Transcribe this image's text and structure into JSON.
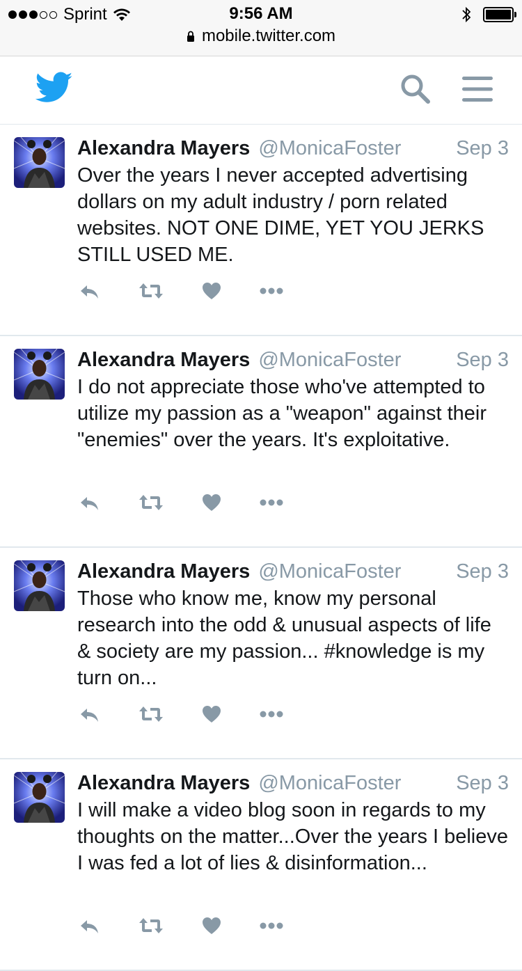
{
  "status_bar": {
    "carrier": "Sprint",
    "time": "9:56 AM",
    "url": "mobile.twitter.com"
  },
  "header": {
    "logo": "twitter-bird-icon",
    "search_icon": "search-icon",
    "menu_icon": "hamburger-menu-icon"
  },
  "colors": {
    "brand": "#1da1f2",
    "icon_gray": "#8899a6",
    "text": "#14171a"
  },
  "tweets": [
    {
      "name": "Alexandra Mayers",
      "handle": "@MonicaFoster",
      "date": "Sep 3",
      "text": "Over the years I never accepted advertising dollars on my adult industry / porn related websites. NOT ONE DIME, YET YOU JERKS STILL USED ME."
    },
    {
      "name": "Alexandra Mayers",
      "handle": "@MonicaFoster",
      "date": "Sep 3",
      "text": "I do not appreciate those who've attempted to utilize my passion as a \"weapon\" against their \"enemies\" over the years. It's exploitative."
    },
    {
      "name": "Alexandra Mayers",
      "handle": "@MonicaFoster",
      "date": "Sep 3",
      "text": "Those who know me, know my personal research into the odd & unusual aspects of life & society are my passion... #knowledge is my turn on..."
    },
    {
      "name": "Alexandra Mayers",
      "handle": "@MonicaFoster",
      "date": "Sep 3",
      "text": "I will make a video blog soon in regards to my thoughts on the matter...Over the years I believe I was fed a lot of lies & disinformation..."
    }
  ],
  "actions": [
    "reply-icon",
    "retweet-icon",
    "like-icon",
    "more-icon"
  ]
}
